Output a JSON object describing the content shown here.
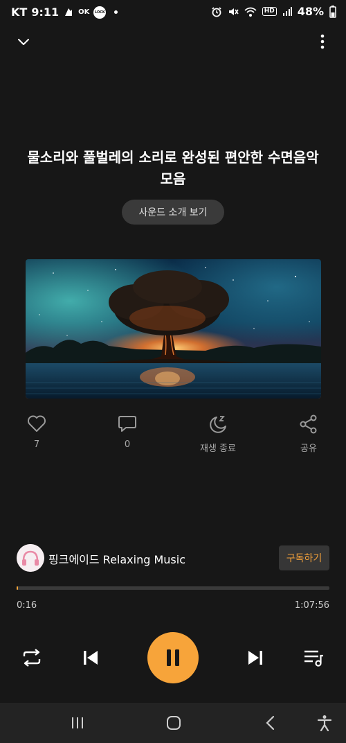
{
  "status_bar": {
    "carrier": "KT",
    "time": "9:11",
    "ok_badge": "OK",
    "lock_badge": "LOCK",
    "network": "HD",
    "battery": "48%"
  },
  "track": {
    "title": "물소리와 풀벌레의 소리로 완성된 편안한 수면음악 모음",
    "intro_button": "사운드 소개 보기"
  },
  "actions": {
    "like_count": "7",
    "comment_count": "0",
    "sleep_timer_label": "재생 종료",
    "share_label": "공유"
  },
  "channel": {
    "name": "핑크에이드 Relaxing Music",
    "subscribe_label": "구독하기"
  },
  "playback": {
    "current_time": "0:16",
    "total_time": "1:07:56",
    "progress_fraction": 0.004,
    "state": "playing"
  },
  "colors": {
    "accent": "#f7a43a",
    "background": "#171717"
  },
  "icons": [
    "chevron-down-icon",
    "more-vertical-icon",
    "heart-icon",
    "comment-icon",
    "sleep-timer-icon",
    "share-icon",
    "repeat-icon",
    "previous-icon",
    "pause-icon",
    "next-icon",
    "playlist-icon",
    "recent-apps-icon",
    "home-icon",
    "back-icon",
    "accessibility-icon"
  ]
}
